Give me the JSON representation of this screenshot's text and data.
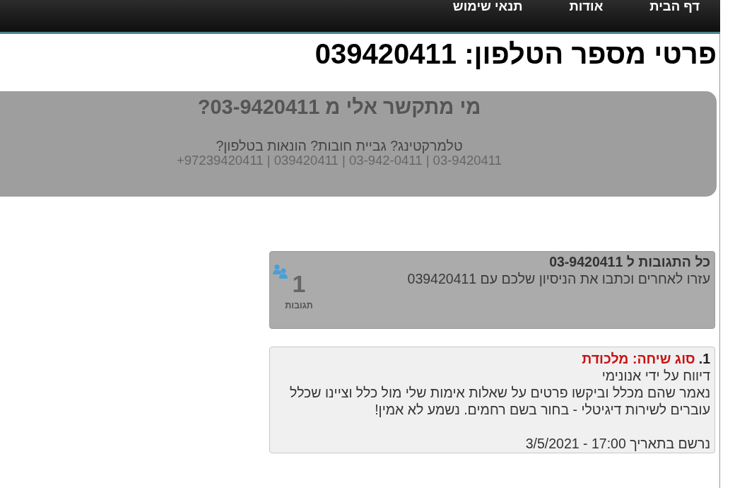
{
  "nav": {
    "items": [
      {
        "label": "דף הבית"
      },
      {
        "label": "אודות"
      },
      {
        "label": "תנאי שימוש"
      }
    ]
  },
  "page_title": "פרטי מספר הטלפון: 039420411",
  "banner": {
    "title": "מי מתקשר אלי מ 03-9420411?",
    "subtitle": "טלמרקטינג? גביית חובות? הונאות בטלפון?",
    "number_formats": "+97239420411 | 039420411 | 03-942-0411 | 03-9420411"
  },
  "comments_summary": {
    "title": "כל התגובות ל 03-9420411",
    "subtitle": "עזרו לאחרים וכתבו את הניסיון שלכם עם 039420411",
    "count": "1",
    "count_label": "תגובות"
  },
  "comments": [
    {
      "number": "1.",
      "call_type": "סוג שיחה: מלכודת",
      "reporter": "דיווח על ידי אנונימי",
      "text": "נאמר שהם מכלל וביקשו פרטים על שאלות אימות שלי מול כלל וציינו שכלל עוברים לשירות דיגיטלי - בחור בשם רחמים. נשמע לא אמין!",
      "date": "נרשם בתאריך 17:00 - 3/5/2021"
    }
  ]
}
